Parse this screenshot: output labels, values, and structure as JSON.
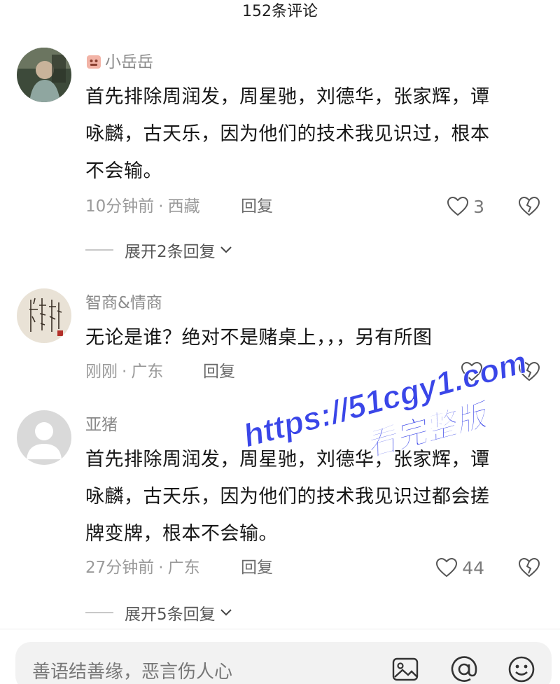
{
  "header": {
    "title": "152条评论"
  },
  "comments": [
    {
      "username": "小岳岳",
      "text_lines": [
        "首先排除周润发，周星驰，刘德华，张家辉，谭",
        "咏麟，古天乐，因为他们的技术我见识过，根本",
        "不会输。"
      ],
      "time": "10分钟前",
      "location": "西藏",
      "reply_label": "回复",
      "likes": "3",
      "expand_label": "展开2条回复"
    },
    {
      "username": "智商&情商",
      "text_lines": [
        "无论是谁？绝对不是赌桌上，，，另有所图"
      ],
      "time": "刚刚",
      "location": "广东",
      "reply_label": "回复",
      "likes": ""
    },
    {
      "username": "亚猪",
      "text_lines": [
        "首先排除周润发，周星驰，刘德华，张家辉，谭",
        "咏麟，古天乐，因为他们的技术我见识过都会搓",
        "牌变牌，根本不会输。"
      ],
      "time": "27分钟前",
      "location": "广东",
      "reply_label": "回复",
      "likes": "44",
      "expand_label": "展开5条回复"
    }
  ],
  "watermark": {
    "line1": "https://51cgy1.com",
    "line2": "看完整版",
    "color": "#3a46e8"
  },
  "composer": {
    "placeholder": "善语结善缘，恶言伤人心",
    "icons": [
      "image-icon",
      "at-icon",
      "emoji-icon"
    ]
  },
  "colors": {
    "text": "#161616",
    "meta": "#9a9a9a",
    "icon_stroke": "#555555"
  }
}
